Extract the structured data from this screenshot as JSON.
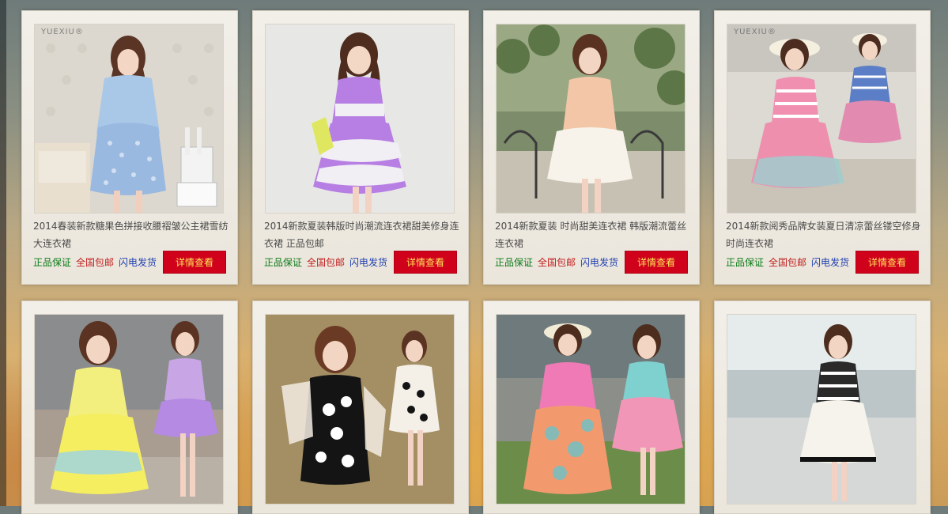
{
  "products": [
    {
      "brand": "YUEXIU®",
      "title": "2014春装新款糖果色拼接收腰褶皱公主裙雪纺大连衣裙",
      "tags": [
        "正品保证",
        "全国包邮",
        "闪电发货"
      ],
      "button": "详情查看"
    },
    {
      "brand": "",
      "title": "2014新款夏装韩版时尚潮流连衣裙甜美修身连衣裙 正品包邮",
      "tags": [
        "正品保证",
        "全国包邮",
        "闪电发货"
      ],
      "button": "详情查看"
    },
    {
      "brand": "",
      "title": "2014新款夏装 时尚甜美连衣裙 韩版潮流蕾丝连衣裙",
      "tags": [
        "正品保证",
        "全国包邮",
        "闪电发货"
      ],
      "button": "详情查看"
    },
    {
      "brand": "YUEXIU®",
      "title": "2014新款阅秀品牌女装夏日清凉蕾丝镂空修身时尚连衣裙",
      "tags": [
        "正品保证",
        "全国包邮",
        "闪电发货"
      ],
      "button": "详情查看"
    },
    {
      "brand": ""
    },
    {
      "brand": ""
    },
    {
      "brand": ""
    },
    {
      "brand": ""
    }
  ],
  "colors": {
    "tag_guarantee": "#0a7a16",
    "tag_shipping": "#c11f1f",
    "tag_fast": "#1f3fb0",
    "button_bg": "#d0021b",
    "button_text": "#ffe65a"
  }
}
